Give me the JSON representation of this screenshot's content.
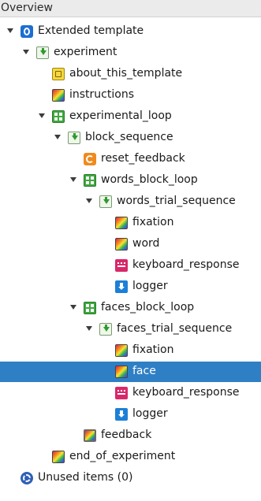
{
  "panel": {
    "title": "Overview"
  },
  "tree": {
    "root": "Extended template",
    "experiment": "experiment",
    "about": "about_this_template",
    "instructions": "instructions",
    "experimental_loop": "experimental_loop",
    "block_sequence": "block_sequence",
    "reset_feedback": "reset_feedback",
    "words_block_loop": "words_block_loop",
    "words_trial_sequence": "words_trial_sequence",
    "words_fixation": "fixation",
    "word": "word",
    "words_keyboard_response": "keyboard_response",
    "words_logger": "logger",
    "faces_block_loop": "faces_block_loop",
    "faces_trial_sequence": "faces_trial_sequence",
    "faces_fixation": "fixation",
    "face": "face",
    "faces_keyboard_response": "keyboard_response",
    "faces_logger": "logger",
    "feedback": "feedback",
    "end_of_experiment": "end_of_experiment",
    "unused_items": "Unused items (0)"
  },
  "selected_item": "face"
}
